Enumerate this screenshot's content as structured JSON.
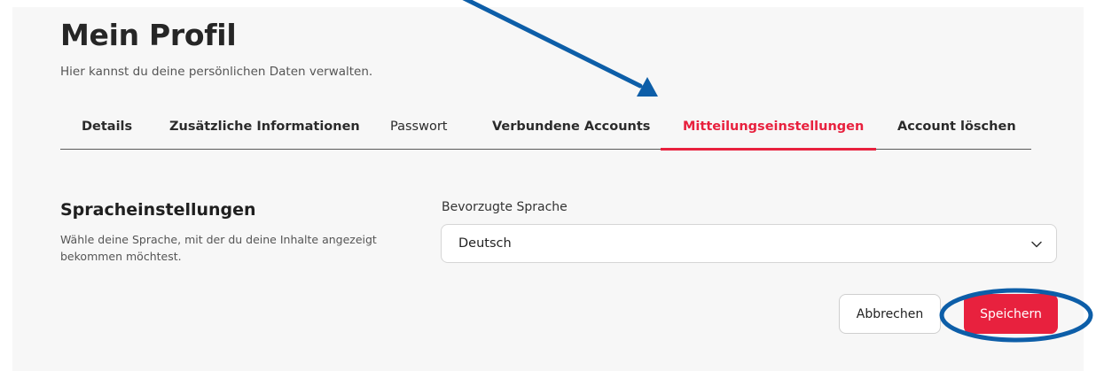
{
  "page": {
    "title": "Mein Profil",
    "subtitle": "Hier kannst du deine persönlichen Daten verwalten."
  },
  "tabs": [
    {
      "label": "Details"
    },
    {
      "label": "Zusätzliche Informationen"
    },
    {
      "label": "Passwort"
    },
    {
      "label": "Verbundene Accounts"
    },
    {
      "label": "Mitteilungseinstellungen",
      "active": true
    },
    {
      "label": "Account löschen"
    }
  ],
  "language_section": {
    "title": "Spracheinstellungen",
    "description": "Wähle deine Sprache, mit der du deine Inhalte angezeigt bekommen möchtest.",
    "field_label": "Bevorzugte Sprache",
    "selected_value": "Deutsch"
  },
  "actions": {
    "cancel_label": "Abbrechen",
    "save_label": "Speichern"
  },
  "colors": {
    "accent": "#e8213e",
    "annotation": "#0d5ea8"
  },
  "icons": {
    "select_chevron": "chevron-down-icon"
  }
}
